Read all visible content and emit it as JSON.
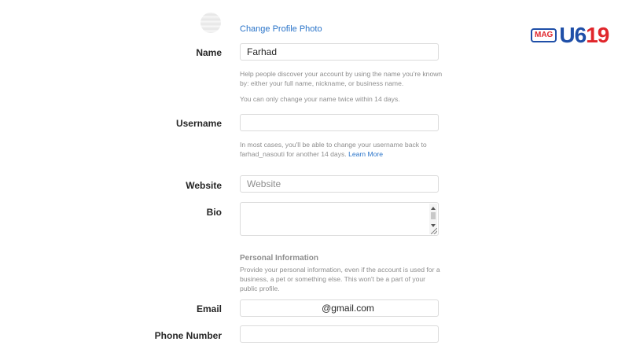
{
  "profile": {
    "change_photo_label": "Change Profile Photo"
  },
  "form": {
    "name": {
      "label": "Name",
      "value": "Farhad",
      "help1": "Help people discover your account by using the name you're known by: either your full name, nickname, or business name.",
      "help2": "You can only change your name twice within 14 days."
    },
    "username": {
      "label": "Username",
      "value": "",
      "help": "In most cases, you'll be able to change your username back to farhad_nasouti for another 14 days.",
      "learn_more": "Learn More"
    },
    "website": {
      "label": "Website",
      "placeholder": "Website"
    },
    "bio": {
      "label": "Bio",
      "value": ""
    },
    "personal_info": {
      "title": "Personal Information",
      "help": "Provide your personal information, even if the account is used for a business, a pet or something else. This won't be a part of your public profile."
    },
    "email": {
      "label": "Email",
      "value": "@gmail.com"
    },
    "phone": {
      "label": "Phone Number",
      "value": ""
    }
  },
  "logo": {
    "mag": "MAG",
    "word_blue": "U6",
    "word_red": "19"
  },
  "colors": {
    "link": "#2a74c9",
    "logo_blue": "#1f4fa8",
    "logo_red": "#e0262b"
  }
}
